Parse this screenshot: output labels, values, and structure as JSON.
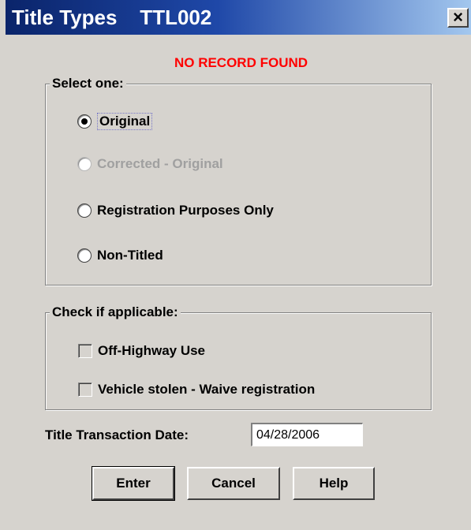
{
  "window": {
    "title": "Title Types    TTL002",
    "close_label": "×"
  },
  "status": {
    "message": "NO RECORD FOUND",
    "color": "#ff0000"
  },
  "select_group": {
    "label": "Select one:",
    "options": [
      {
        "label": "Original",
        "checked": true,
        "enabled": true
      },
      {
        "label": "Corrected - Original",
        "checked": false,
        "enabled": false
      },
      {
        "label": "Registration Purposes Only",
        "checked": false,
        "enabled": true
      },
      {
        "label": "Non-Titled",
        "checked": false,
        "enabled": true
      }
    ]
  },
  "check_group": {
    "label": "Check if applicable:",
    "options": [
      {
        "label": "Off-Highway Use",
        "checked": false
      },
      {
        "label": "Vehicle stolen - Waive registration",
        "checked": false
      }
    ]
  },
  "date_field": {
    "label": "Title Transaction Date:",
    "value": "04/28/2006"
  },
  "buttons": {
    "enter": "Enter",
    "cancel": "Cancel",
    "help": "Help"
  },
  "colors": {
    "titlebar_start": "#0a246a",
    "titlebar_end": "#a6caf0",
    "window_bg": "#d6d3ce"
  }
}
